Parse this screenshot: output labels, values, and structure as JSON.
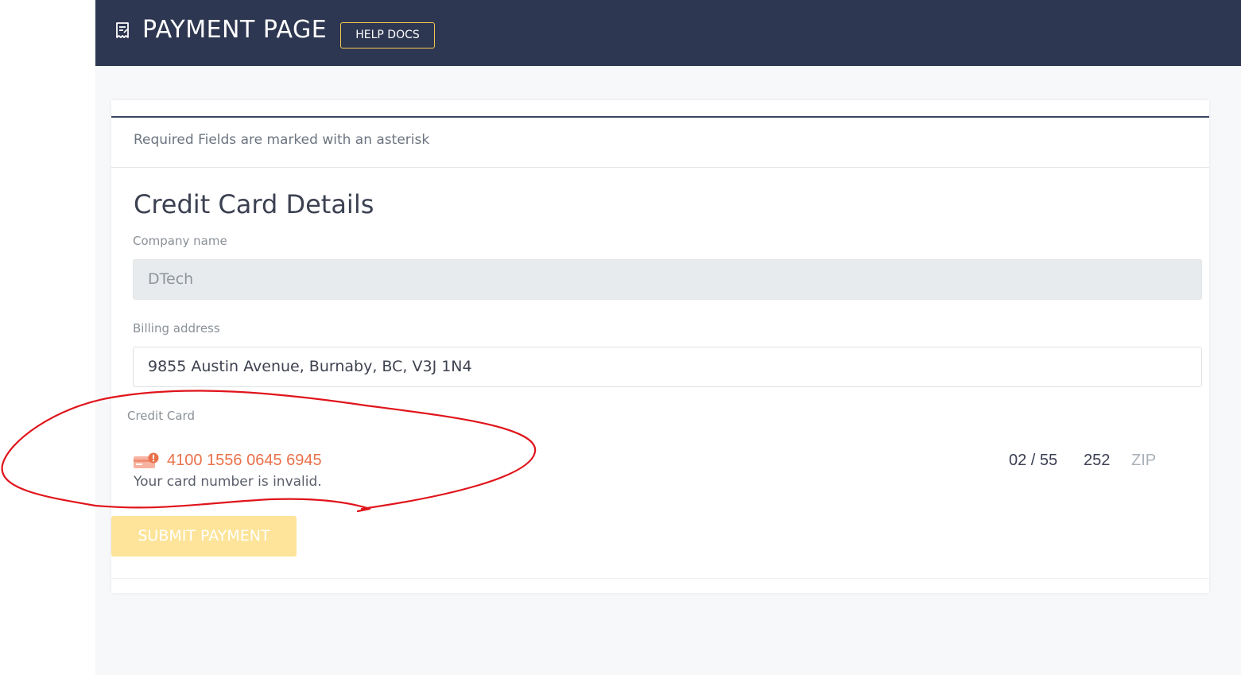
{
  "header": {
    "title": "PAYMENT PAGE",
    "help_button_label": "HELP DOCS",
    "icon": "receipt-icon"
  },
  "form": {
    "required_note": "Required Fields are marked with an asterisk",
    "section_title": "Credit Card Details",
    "company_name_label": "Company name",
    "company_name_value": "DTech",
    "billing_address_label": "Billing address",
    "billing_address_value": "9855 Austin Avenue, Burnaby, BC, V3J 1N4",
    "credit_card_label": "Credit Card",
    "card": {
      "icon": "card-error-icon",
      "number": "4100 1556 0645 6945",
      "expiry": "02 / 55",
      "cvc": "252",
      "zip_placeholder": "ZIP",
      "error_message": "Your card number is invalid."
    },
    "submit_label": "SUBMIT PAYMENT"
  },
  "colors": {
    "header_bg": "#2e3751",
    "accent_yellow": "#f3c94e",
    "error": "#e9714a",
    "submit_disabled": "#fde49a",
    "annotation": "#e0141b"
  }
}
